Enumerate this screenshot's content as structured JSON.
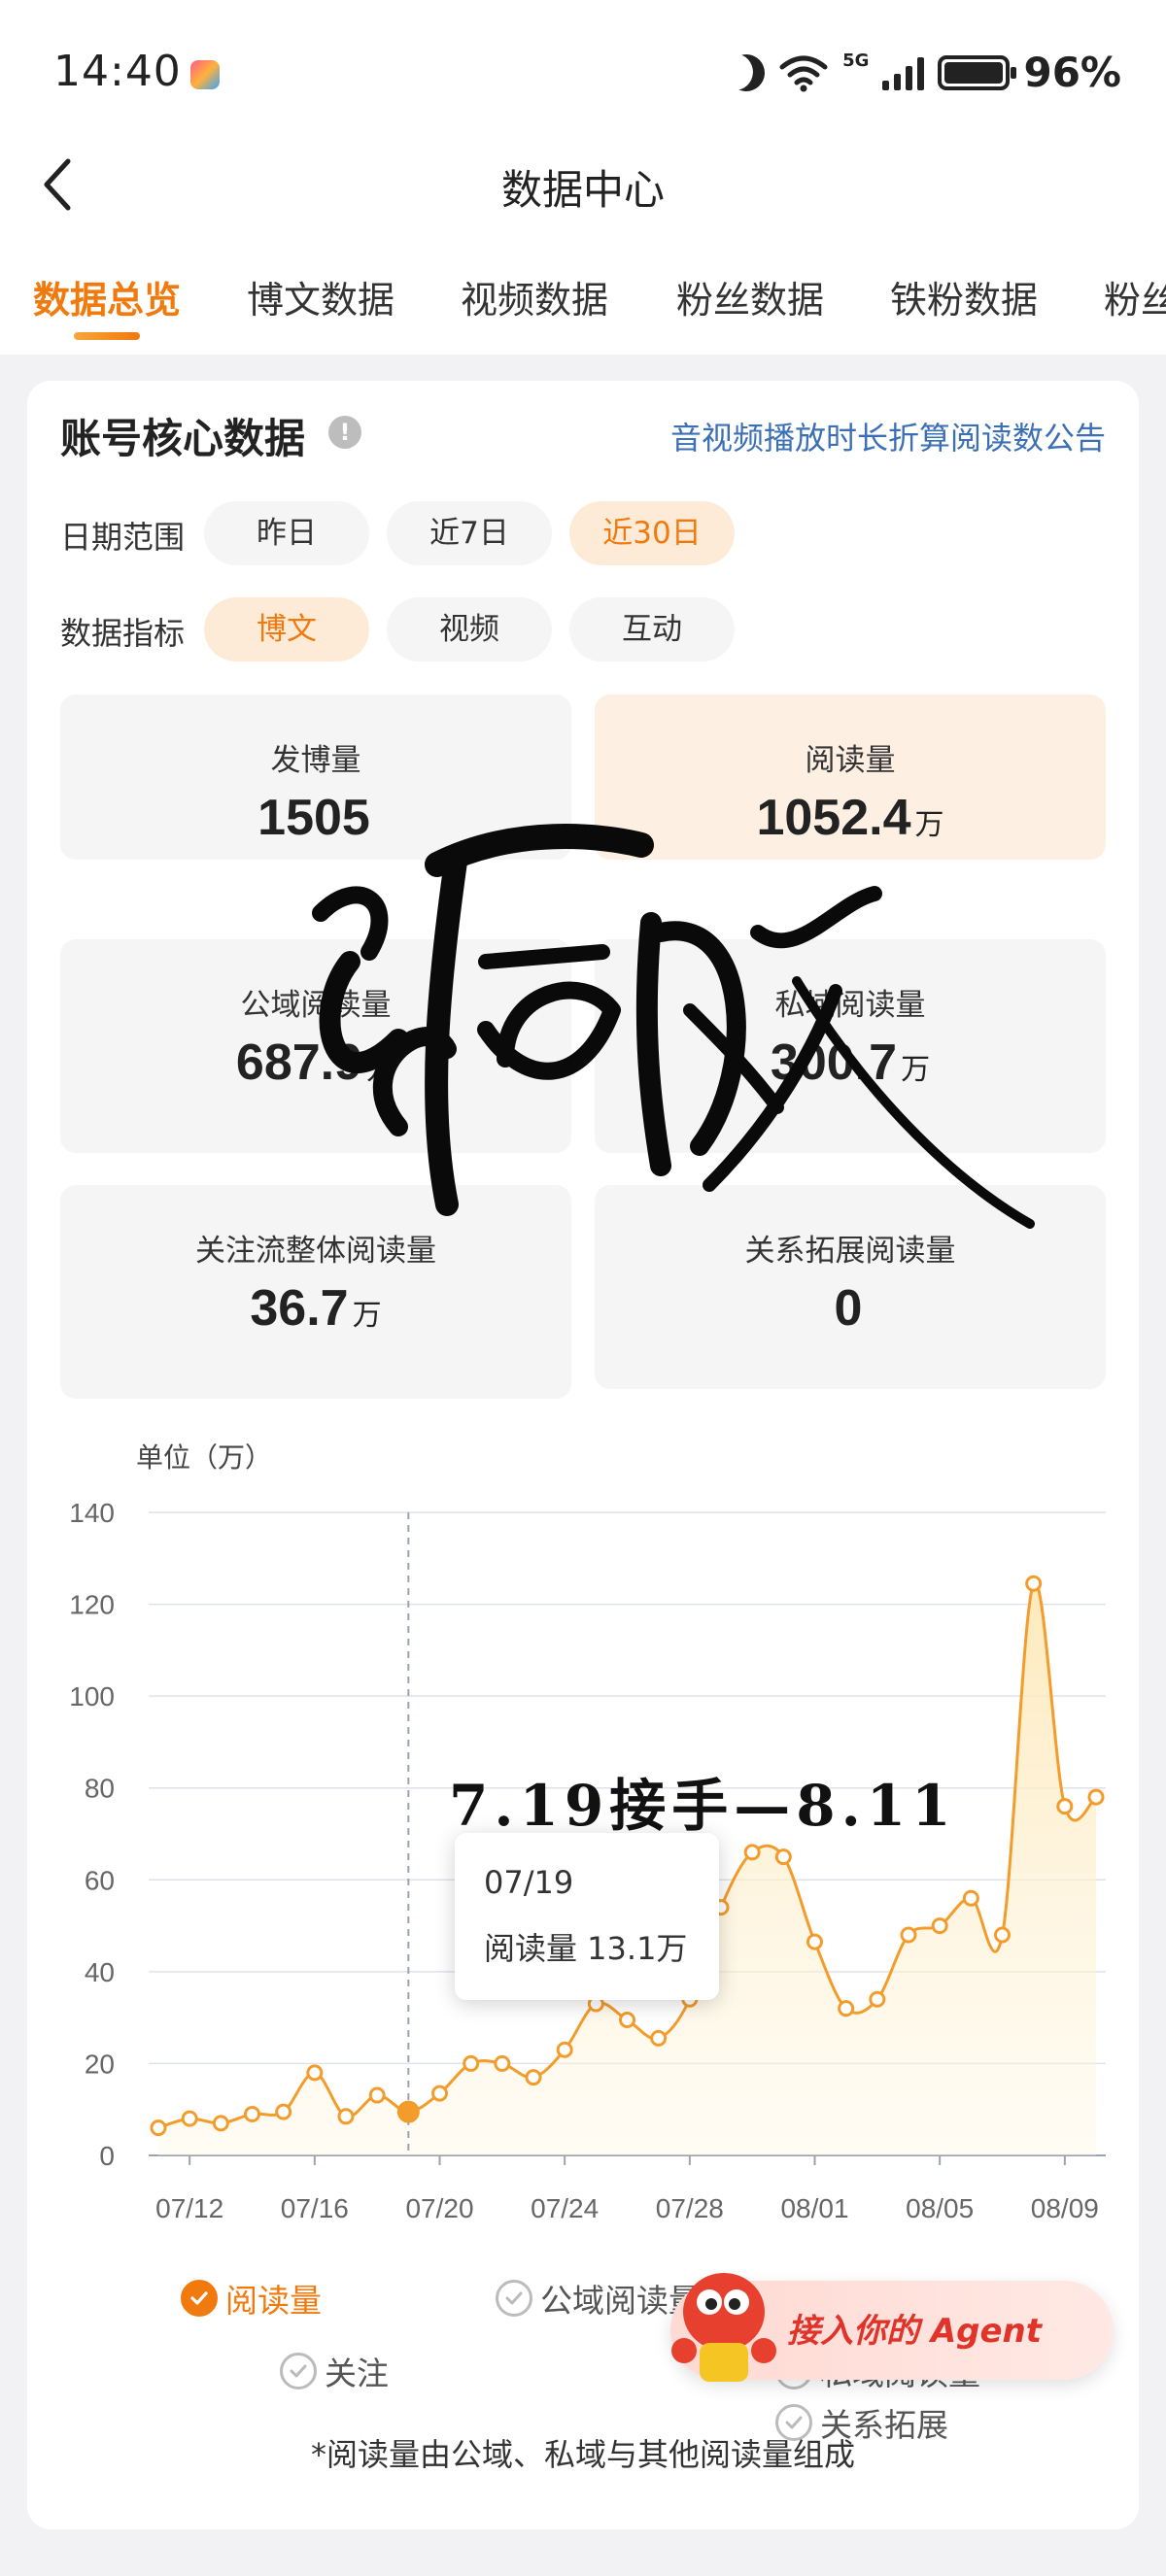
{
  "status_bar": {
    "time": "14:40",
    "network": "5G",
    "battery": "96%"
  },
  "nav": {
    "title": "数据中心"
  },
  "tabs": [
    "数据总览",
    "博文数据",
    "视频数据",
    "粉丝数据",
    "铁粉数据",
    "粉丝"
  ],
  "card": {
    "title": "账号核心数据",
    "notice_link": "音视频播放时长折算阅读数公告",
    "date_range": {
      "label": "日期范围",
      "options": [
        "昨日",
        "近7日",
        "近30日"
      ],
      "selected": "近30日"
    },
    "metric": {
      "label": "数据指标",
      "options": [
        "博文",
        "视频",
        "互动"
      ],
      "selected": "博文"
    },
    "stats": [
      {
        "label": "发博量",
        "value": "1505",
        "unit": ""
      },
      {
        "label": "阅读量",
        "value": "1052.4",
        "unit": "万"
      },
      {
        "label": "公域阅读量",
        "value": "687.9",
        "unit": "万"
      },
      {
        "label": "私域阅读量",
        "value": "300.7",
        "unit": "万"
      },
      {
        "label": "关注流整体阅读量",
        "value": "36.7",
        "unit": "万"
      },
      {
        "label": "关系拓展阅读量",
        "value": "0",
        "unit": ""
      }
    ]
  },
  "chart_data": {
    "type": "area",
    "unit_label": "单位（万）",
    "ylim": [
      0,
      140
    ],
    "y_ticks": [
      0,
      20,
      40,
      60,
      80,
      100,
      120,
      140
    ],
    "x_tick_labels": [
      "07/12",
      "07/16",
      "07/20",
      "07/24",
      "07/28",
      "08/01",
      "08/05",
      "08/09"
    ],
    "x": [
      "07/11",
      "07/12",
      "07/13",
      "07/14",
      "07/15",
      "07/16",
      "07/17",
      "07/18",
      "07/19",
      "07/20",
      "07/21",
      "07/22",
      "07/23",
      "07/24",
      "07/25",
      "07/26",
      "07/27",
      "07/28",
      "07/29",
      "07/30",
      "07/31",
      "08/01",
      "08/02",
      "08/03",
      "08/04",
      "08/05",
      "08/06",
      "08/07",
      "08/08",
      "08/09",
      "08/10"
    ],
    "series": [
      {
        "name": "阅读量",
        "color": "#f39c2b",
        "values": [
          6,
          8,
          7,
          9,
          9.5,
          18,
          8.5,
          13.1,
          9.5,
          13.5,
          20,
          20,
          17,
          23,
          33,
          29.5,
          25.5,
          34,
          54,
          66,
          65,
          46.5,
          32,
          34,
          48,
          50,
          56,
          48,
          124.5,
          76,
          78
        ]
      }
    ],
    "highlight": {
      "x": "07/19",
      "value": 13.1
    },
    "tooltip": {
      "date": "07/19",
      "text": "阅读量  13.1万"
    },
    "legend": [
      {
        "name": "阅读量",
        "checked": true
      },
      {
        "name": "公域阅读量",
        "checked": false
      },
      {
        "name": "私域阅读量",
        "checked": false
      },
      {
        "name": "关注",
        "checked": false
      },
      {
        "name": "关系拓展",
        "checked": false
      }
    ]
  },
  "annotation_handwritten": "7.19接手—8.11",
  "footnote": "*阅读量由公域、私域与其他阅读量组成",
  "agent_banner": "接入你的 Agent",
  "stamp_text": "惜败",
  "colors": {
    "accent": "#f07a0d",
    "link": "#3b6fb6",
    "line": "#f39c2b",
    "banner_text": "#e0332a"
  }
}
